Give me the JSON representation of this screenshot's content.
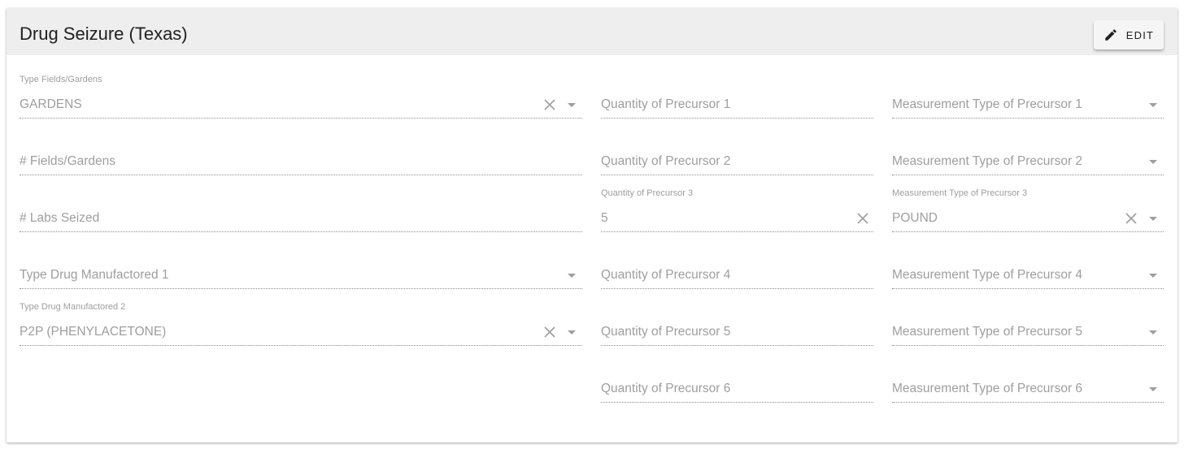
{
  "header": {
    "title": "Drug Seizure (Texas)",
    "edit_label": "Edit"
  },
  "left_column": {
    "type_fields_gardens": {
      "label": "Type Fields/Gardens",
      "value": "GARDENS"
    },
    "num_fields_gardens": {
      "placeholder": "# Fields/Gardens"
    },
    "num_labs_seized": {
      "placeholder": "# Labs Seized"
    },
    "type_drug_manufactured_1": {
      "placeholder": "Type Drug Manufactored 1"
    },
    "type_drug_manufactured_2": {
      "label": "Type Drug Manufactored 2",
      "value": "P2P (PHENYLACETONE)"
    }
  },
  "quantity_column": {
    "precursor_1": {
      "placeholder": "Quantity of Precursor 1"
    },
    "precursor_2": {
      "placeholder": "Quantity of Precursor 2"
    },
    "precursor_3": {
      "label": "Quantity of Precursor 3",
      "value": "5"
    },
    "precursor_4": {
      "placeholder": "Quantity of Precursor 4"
    },
    "precursor_5": {
      "placeholder": "Quantity of Precursor 5"
    },
    "precursor_6": {
      "placeholder": "Quantity of Precursor 6"
    }
  },
  "measurement_column": {
    "precursor_1": {
      "placeholder": "Measurement Type of Precursor 1"
    },
    "precursor_2": {
      "placeholder": "Measurement Type of Precursor 2"
    },
    "precursor_3": {
      "label": "Measurement Type of Precursor 3",
      "value": "POUND"
    },
    "precursor_4": {
      "placeholder": "Measurement Type of Precursor 4"
    },
    "precursor_5": {
      "placeholder": "Measurement Type of Precursor 5"
    },
    "precursor_6": {
      "placeholder": "Measurement Type of Precursor 6"
    }
  },
  "icons": {
    "edit": "pencil-icon",
    "clear": "close-icon",
    "dropdown": "arrow-drop-down-icon"
  },
  "colors": {
    "header_bg": "#eeeeee",
    "text_muted": "#9e9e9e",
    "title_text": "#212121"
  }
}
